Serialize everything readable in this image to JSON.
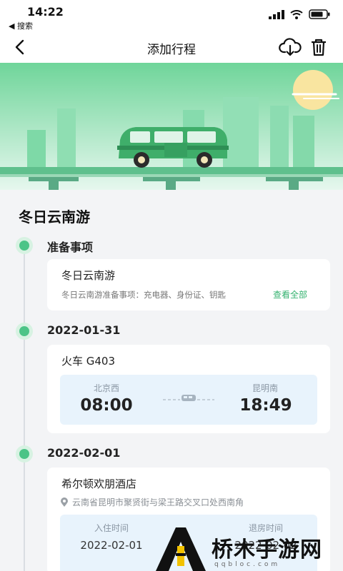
{
  "status_bar": {
    "time": "14:22",
    "back_app": "◀ 搜索"
  },
  "nav": {
    "title": "添加行程"
  },
  "trip": {
    "title": "冬日云南游"
  },
  "sections": {
    "prep": {
      "label": "准备事项",
      "card_title": "冬日云南游",
      "description": "冬日云南游准备事项：充电器、身份证、钥匙",
      "link": "查看全部"
    },
    "day1": {
      "date": "2022-01-31",
      "train_title": "火车 G403",
      "from_station": "北京西",
      "depart_time": "08:00",
      "to_station": "昆明南",
      "arrive_time": "18:49"
    },
    "day2": {
      "date": "2022-02-01",
      "hotel_name": "希尔顿欢朋酒店",
      "address": "云南省昆明市聚贤街与梁王路交叉口处西南角",
      "checkin_label": "入住时间",
      "checkin_date": "2022-02-01",
      "checkout_label": "退房时间",
      "checkout_date": "2022-02-02"
    }
  },
  "watermark": {
    "text": "桥木手游网",
    "sub": "qqbloc.com"
  },
  "colors": {
    "accent": "#4cc487",
    "link": "#34b26f",
    "ticket_bg": "#e8f3fc",
    "bus": "#3fae6a"
  }
}
